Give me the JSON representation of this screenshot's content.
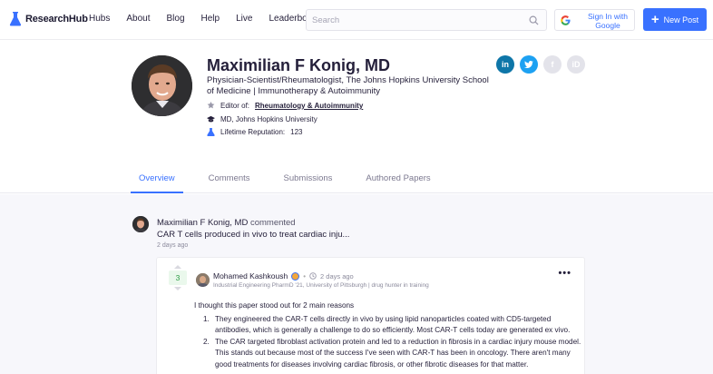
{
  "nav": {
    "logo": "ResearchHub",
    "links": [
      "Hubs",
      "About",
      "Blog",
      "Help",
      "Live",
      "Leaderboard"
    ],
    "search_placeholder": "Search",
    "google_btn": "Sign In with Google",
    "new_post": "New Post",
    "accent": "#3971ff"
  },
  "profile": {
    "name": "Maximilian F Konig, MD",
    "headline": "Physician-Scientist/Rheumatologist, The Johns Hopkins University School of Medicine | Immunotherapy & Autoimmunity",
    "editor_label": "Editor of:",
    "editor_hub": "Rheumatology & Autoimmunity",
    "education": "MD, Johns Hopkins University",
    "reputation_label": "Lifetime Reputation:",
    "reputation": "123",
    "socials": [
      "in",
      "twitter",
      "facebook",
      "iD"
    ]
  },
  "tabs": [
    "Overview",
    "Comments",
    "Submissions",
    "Authored Papers"
  ],
  "activity": {
    "actor": "Maximilian F Konig, MD",
    "verb": "commented",
    "title": "CAR T cells produced in vivo to treat cardiac inju...",
    "time": "2 days ago"
  },
  "comment": {
    "votes": "3",
    "author": "Mohamed Kashkoush",
    "time": "2 days ago",
    "subtitle": "Industrial Engineering PharmD '21, University of Pittsburgh | drug hunter in training",
    "intro": "I thought this paper stood out for 2 main reasons",
    "points": [
      "They engineered the CAR-T cells directly in vivo by using lipid nanoparticles coated with CD5-targeted antibodies, which is generally a challenge to do so efficiently. Most CAR-T cells today are generated ex vivo.",
      "The CAR targeted fibroblast activation protein and led to a reduction in fibrosis in a cardiac injury mouse model. This stands out because most of the success I've seen with CAR-T has been in oncology. There aren't many good treatments for diseases involving cardiac fibrosis, or other fibrotic diseases for that matter."
    ]
  }
}
